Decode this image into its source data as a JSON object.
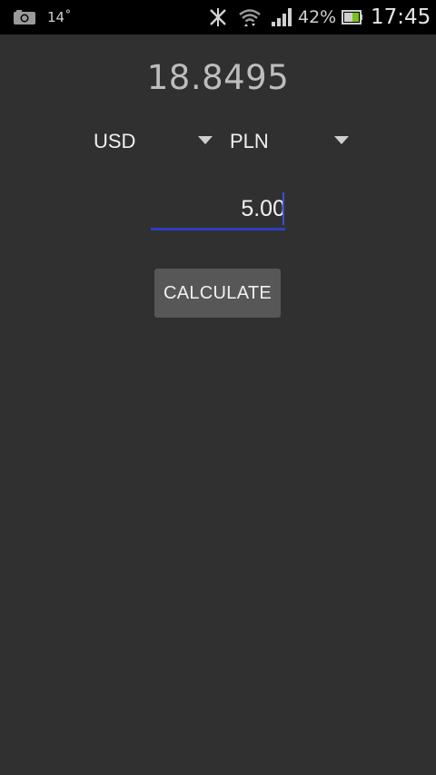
{
  "status_bar": {
    "temperature": "14˚",
    "battery_percent": "42%",
    "time": "17:45",
    "icons": [
      "camera-icon",
      "no-signal-icon",
      "wifi-icon",
      "signal-icon",
      "battery-icon"
    ]
  },
  "converter": {
    "result": "18.8495",
    "from_currency": "USD",
    "to_currency": "PLN",
    "amount_value": "5.00",
    "calculate_label": "CALCULATE"
  },
  "colors": {
    "background": "#303030",
    "status_bar": "#000000",
    "accent_underline": "#2f3fbf",
    "button": "#575757"
  }
}
